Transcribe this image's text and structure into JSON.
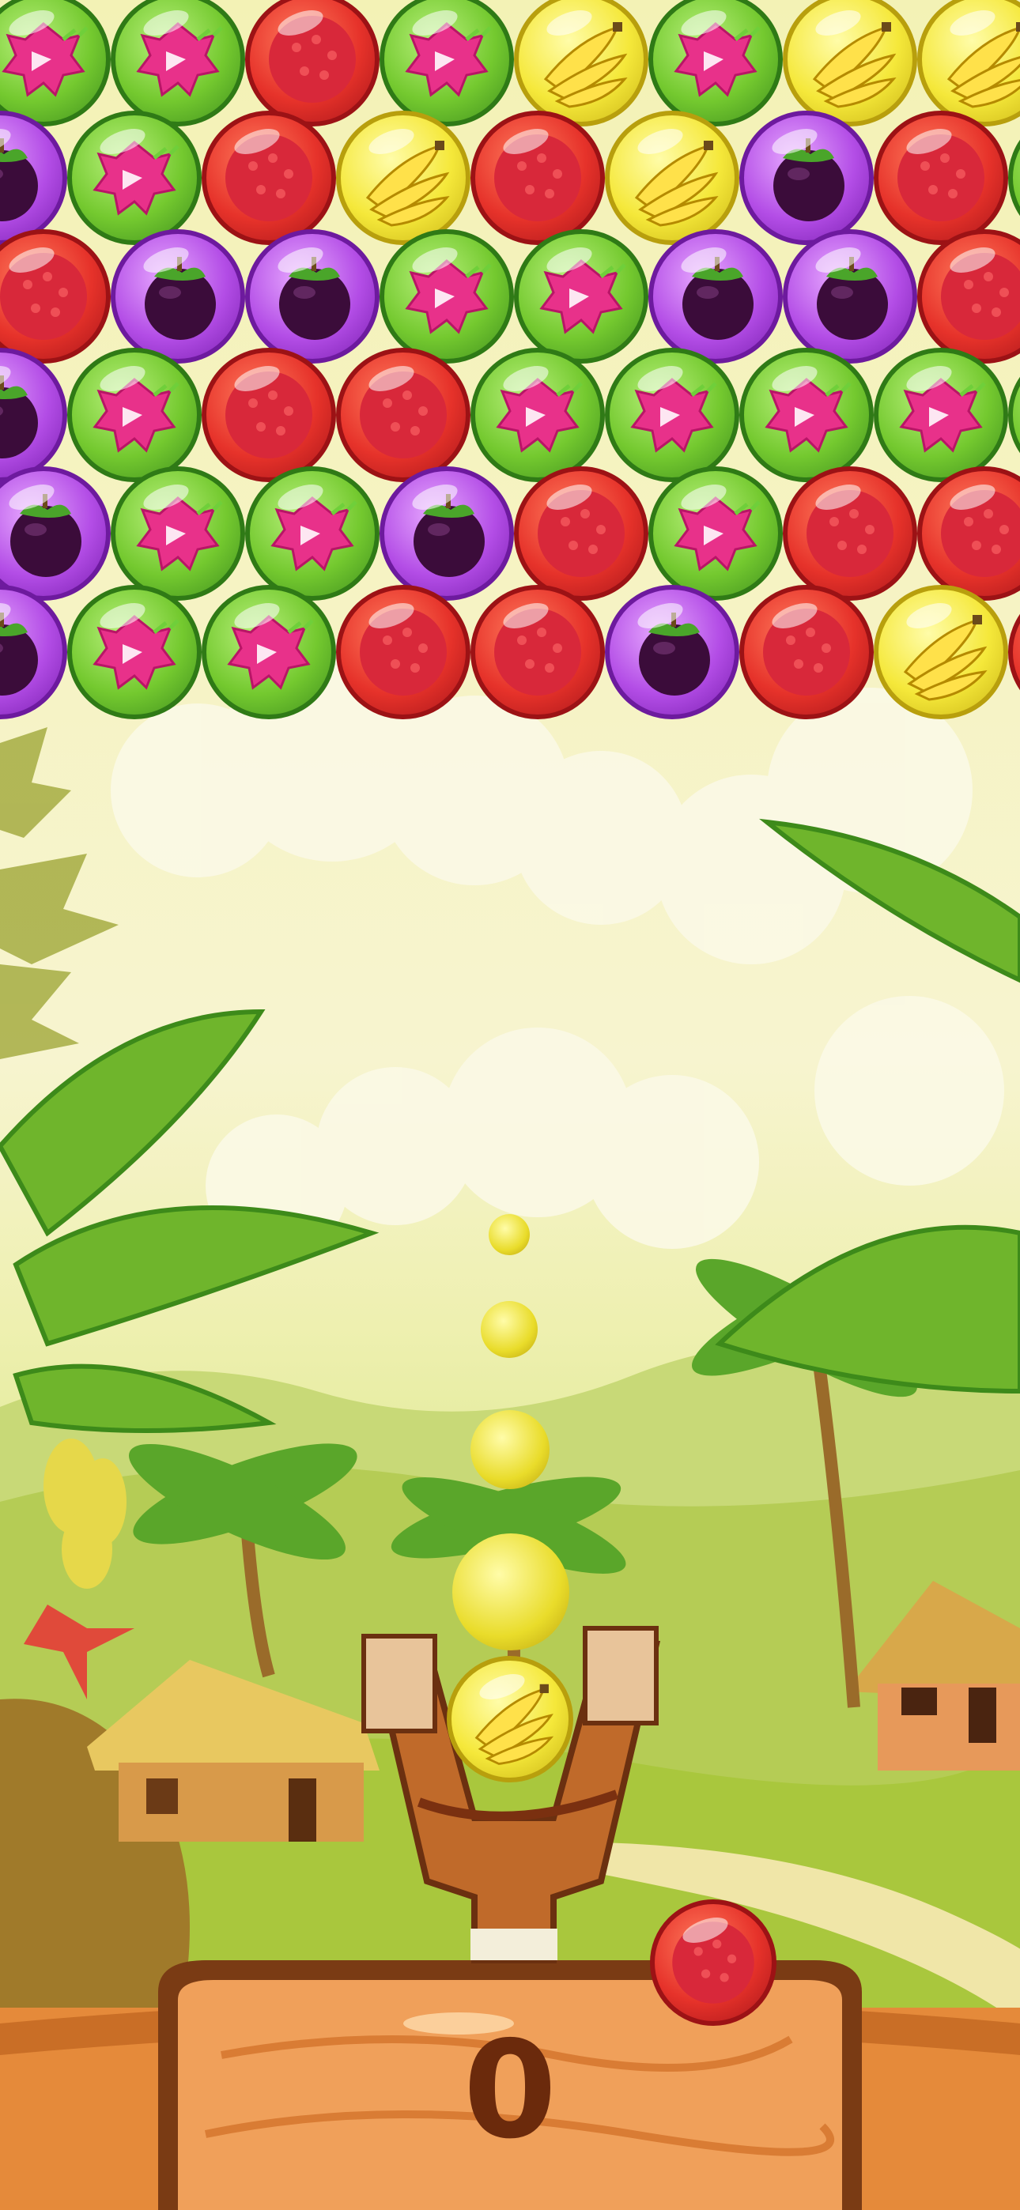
{
  "game": {
    "title": "",
    "score": "0",
    "bubble_kinds": {
      "dragonfruit": {
        "icon": "dragonfruit-icon",
        "color": "#74c92f"
      },
      "rambutan": {
        "icon": "rambutan-icon",
        "color": "#e6322a"
      },
      "banana": {
        "icon": "banana-icon",
        "color": "#f5e83a"
      },
      "mangosteen": {
        "icon": "mangosteen-icon",
        "color": "#b34de6"
      }
    },
    "grid": [
      [
        "dragonfruit",
        "dragonfruit",
        "rambutan",
        "dragonfruit",
        "banana",
        "dragonfruit",
        "banana",
        "banana"
      ],
      [
        "mangosteen",
        "dragonfruit",
        "rambutan",
        "banana",
        "rambutan",
        "banana",
        "mangosteen",
        "rambutan",
        "dragonfruit"
      ],
      [
        "rambutan",
        "mangosteen",
        "mangosteen",
        "dragonfruit",
        "dragonfruit",
        "mangosteen",
        "mangosteen",
        "rambutan"
      ],
      [
        "mangosteen",
        "dragonfruit",
        "rambutan",
        "rambutan",
        "dragonfruit",
        "dragonfruit",
        "dragonfruit",
        "dragonfruit",
        "dragonfruit"
      ],
      [
        "mangosteen",
        "dragonfruit",
        "dragonfruit",
        "mangosteen",
        "rambutan",
        "dragonfruit",
        "rambutan",
        "rambutan"
      ],
      [
        "mangosteen",
        "dragonfruit",
        "dragonfruit",
        "rambutan",
        "rambutan",
        "mangosteen",
        "rambutan",
        "banana",
        "rambutan"
      ]
    ],
    "loaded_bubble": "banana",
    "next_bubble": "rambutan",
    "aim_guide_color": "#e9dc2a"
  }
}
